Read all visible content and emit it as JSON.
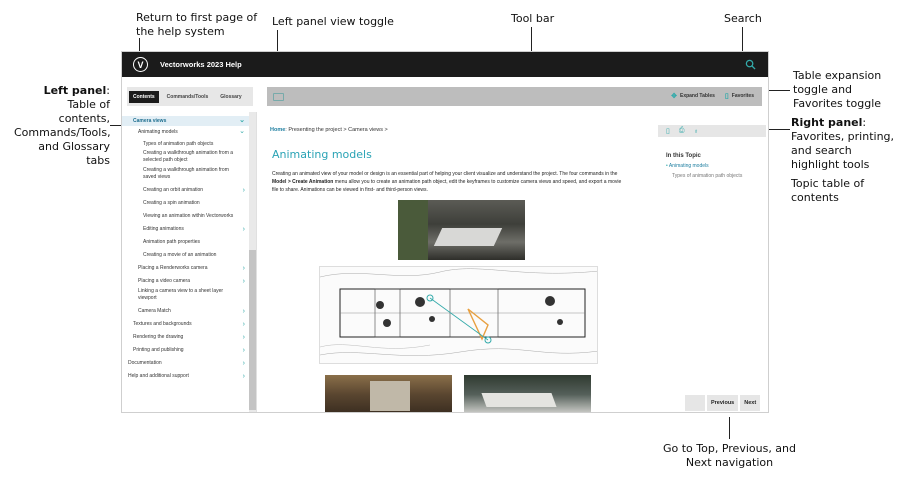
{
  "annotations": {
    "return_home": "Return to first page of the help system",
    "left_toggle": "Left panel view toggle",
    "toolbar": "Tool bar",
    "search": "Search",
    "left_panel_bold": "Left panel",
    "left_panel_desc": ": Table of contents, Commands/Tools, and Glossary tabs",
    "table_expansion": "Table expansion toggle and Favorites toggle",
    "right_panel_bold": "Right panel",
    "right_panel_desc": ": Favorites, printing, and search highlight tools",
    "topic_toc": "Topic table of contents",
    "nav": "Go to Top, Previous, and Next navigation"
  },
  "app": {
    "title": "Vectorworks 2023 Help",
    "logo_letter": "V"
  },
  "tabs": [
    {
      "label": "Contents",
      "active": true
    },
    {
      "label": "Commands/Tools",
      "active": false
    },
    {
      "label": "Glossary",
      "active": false
    }
  ],
  "toolbar": {
    "expand_tables": "Expand Tables",
    "favorites": "Favorites"
  },
  "toc": [
    {
      "label": "Camera views",
      "level": 0,
      "head": true,
      "chev": "down"
    },
    {
      "label": "Animating models",
      "level": 1,
      "chev": "down"
    },
    {
      "label": "Types of animation path objects",
      "level": 2
    },
    {
      "label": "Creating a walkthrough animation from a selected path object",
      "level": 2
    },
    {
      "label": "Creating a walkthrough animation from saved views",
      "level": 2
    },
    {
      "label": "Creating an orbit animation",
      "level": 2,
      "chev": "right"
    },
    {
      "label": "Creating a spin animation",
      "level": 2
    },
    {
      "label": "Viewing an animation within Vectorworks",
      "level": 2
    },
    {
      "label": "Editing animations",
      "level": 2,
      "chev": "right"
    },
    {
      "label": "Animation path properties",
      "level": 2
    },
    {
      "label": "Creating a movie of an animation",
      "level": 2
    },
    {
      "label": "Placing a Renderworks camera",
      "level": 1,
      "chev": "right"
    },
    {
      "label": "Placing a video camera",
      "level": 1,
      "chev": "right"
    },
    {
      "label": "Linking a camera view to a sheet layer viewport",
      "level": 1
    },
    {
      "label": "Camera Match",
      "level": 1,
      "chev": "right"
    },
    {
      "label": "Textures and backgrounds",
      "level": 0,
      "chev": "right"
    },
    {
      "label": "Rendering the drawing",
      "level": 0,
      "chev": "right"
    },
    {
      "label": "Printing and publishing",
      "level": 0,
      "chev": "right"
    },
    {
      "label": "Documentation",
      "level": -1,
      "chev": "right"
    },
    {
      "label": "Help and additional support",
      "level": -1,
      "chev": "right"
    }
  ],
  "breadcrumb": {
    "home": "Home",
    "rest": ": Presenting the project  >  Camera views  >"
  },
  "topic": {
    "title": "Animating models",
    "body_1": "Creating an animated view of your model or design is an essential part of helping your client visualize and understand the project. The four commands in the ",
    "body_bold": "Model > Create Animation",
    "body_2": " menu allow you to create an animation path object, edit the keyframes to customize camera views and speed, and export a movie file to share. Animations can be viewed in first- and third-person views."
  },
  "right_panel": {
    "in_this_topic": "In this Topic",
    "item1": "Animating models",
    "item2": "Types of animation path objects"
  },
  "nav": {
    "previous": "Previous",
    "next": "Next"
  }
}
